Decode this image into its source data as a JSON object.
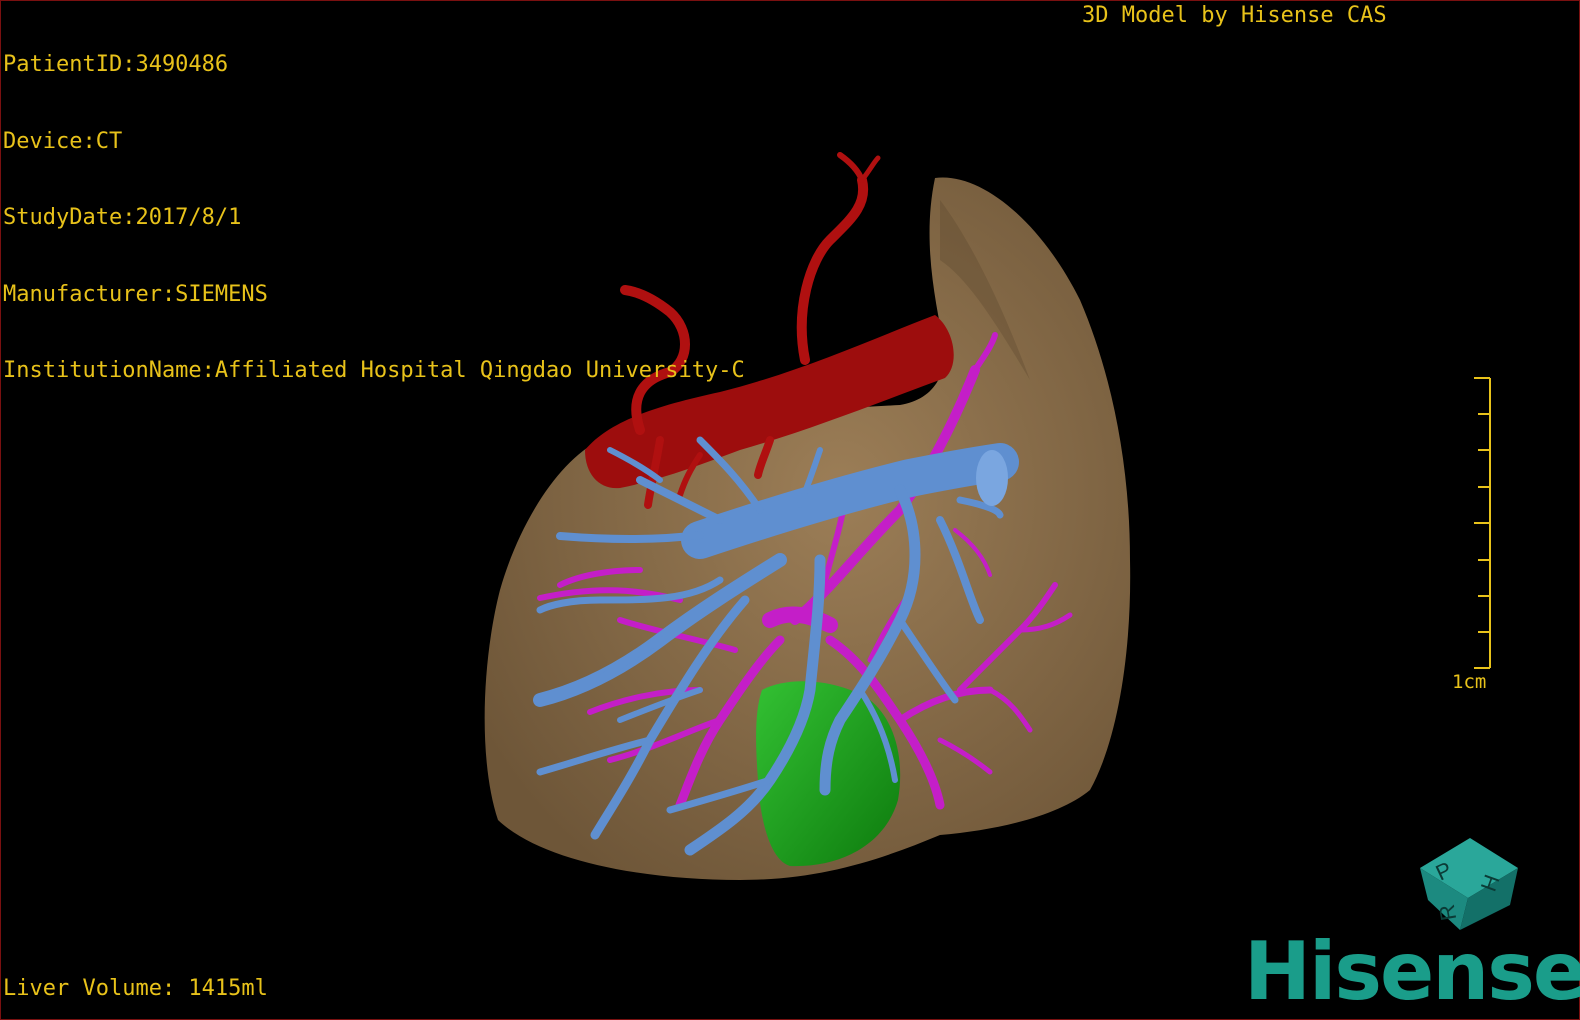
{
  "header": {
    "patient_id": "PatientID:3490486",
    "device": "Device:CT",
    "study_date": "StudyDate:2017/8/1",
    "manufacturer": "Manufacturer:SIEMENS",
    "institution": "InstitutionName:Affiliated Hospital Qingdao University-C"
  },
  "brand_title": "3D Model by Hisense CAS",
  "footer": {
    "liver_volume": "Liver Volume: 1415ml"
  },
  "scale_bar": {
    "label": "1cm"
  },
  "orientation_cube": {
    "faces": [
      "P",
      "H",
      "R"
    ]
  },
  "logo": {
    "text": "Hisense"
  },
  "colors": {
    "text": "#e8c21a",
    "liver": "#8a6e4b",
    "artery": "#b01010",
    "portal_vein": "#5f8fd0",
    "hepatic_vein": "#c41ec8",
    "gallbladder": "#1a9e1a",
    "cube": "#1f8f85",
    "logo": "#1a9d8a"
  },
  "structures": [
    "liver",
    "aorta",
    "hepatic-artery",
    "portal-vein",
    "hepatic-vein",
    "gallbladder"
  ]
}
